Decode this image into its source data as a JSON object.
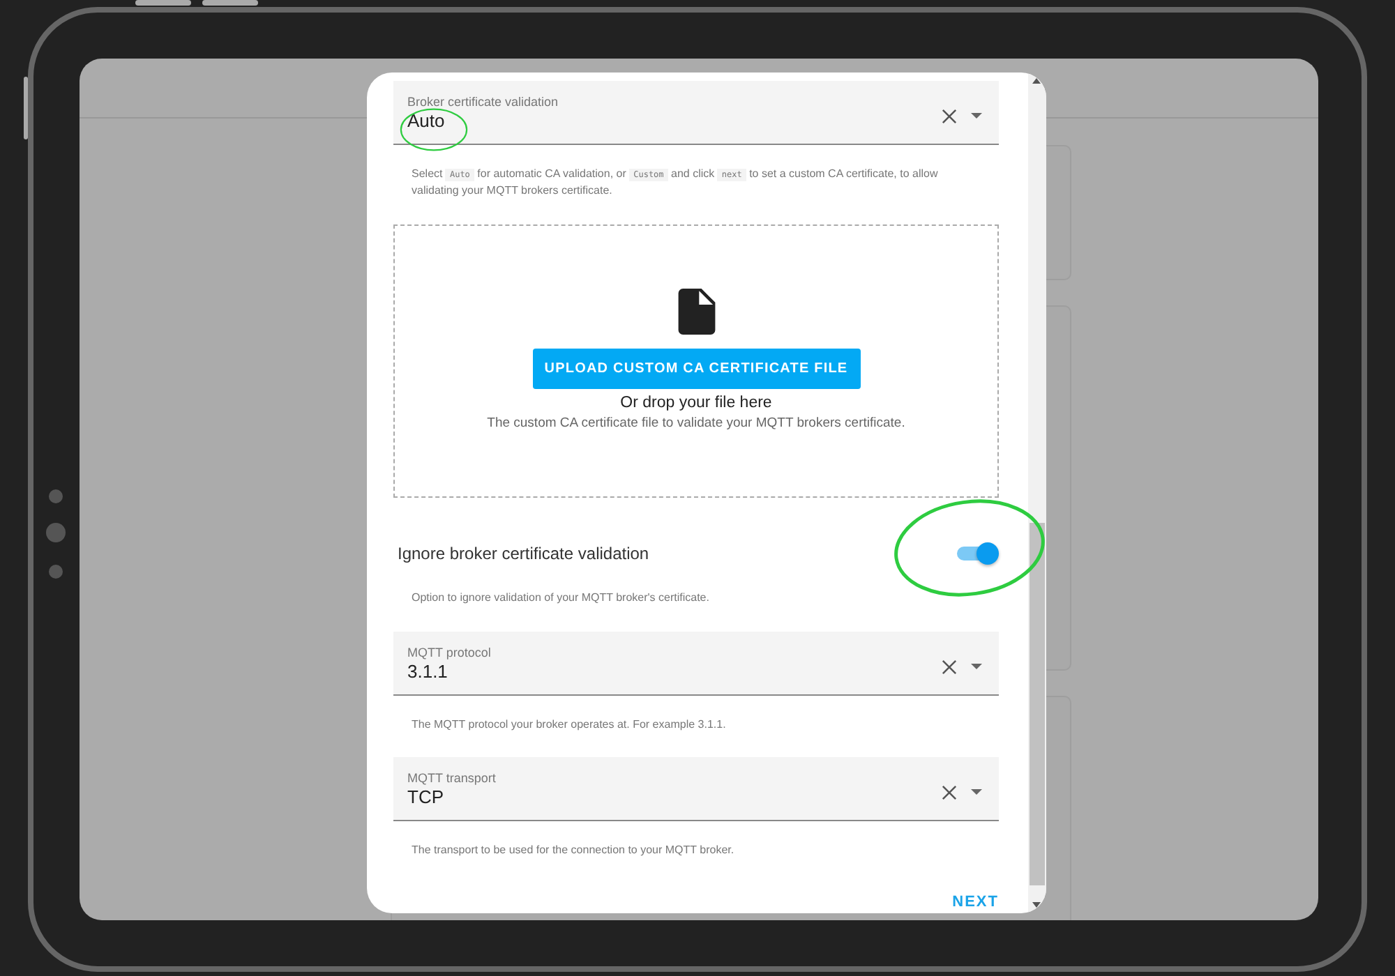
{
  "dialog": {
    "sections": [
      {
        "kind": "select",
        "label": "Broker certificate validation",
        "value": "Auto",
        "helper": [
          {
            "kind": "text",
            "text": "Select"
          },
          {
            "kind": "code",
            "text": "Auto"
          },
          {
            "kind": "text",
            "text": "for automatic CA validation, or"
          },
          {
            "kind": "code",
            "text": "Custom"
          },
          {
            "kind": "text",
            "text": "and click"
          },
          {
            "kind": "code",
            "text": "next"
          },
          {
            "kind": "text",
            "text": "to set a custom CA certificate, to allow validating your MQTT brokers certificate."
          }
        ]
      },
      {
        "kind": "upload",
        "button": "UPLOAD CUSTOM CA CERTIFICATE FILE",
        "drop_text": "Or drop your file here",
        "description": "The custom CA certificate file to validate your MQTT brokers certificate."
      },
      {
        "kind": "toggle",
        "label": "Ignore broker certificate validation",
        "on": true,
        "helper": [
          {
            "kind": "text",
            "text": "Option to ignore validation of your MQTT broker's certificate."
          }
        ]
      },
      {
        "kind": "select",
        "label": "MQTT protocol",
        "value": "3.1.1",
        "helper": [
          {
            "kind": "text",
            "text": "The MQTT protocol your broker operates at. For example 3.1.1."
          }
        ]
      },
      {
        "kind": "select",
        "label": "MQTT transport",
        "value": "TCP",
        "helper": [
          {
            "kind": "text",
            "text": "The transport to be used for the connection to your MQTT broker."
          }
        ]
      }
    ],
    "actions": [
      "NEXT"
    ]
  }
}
